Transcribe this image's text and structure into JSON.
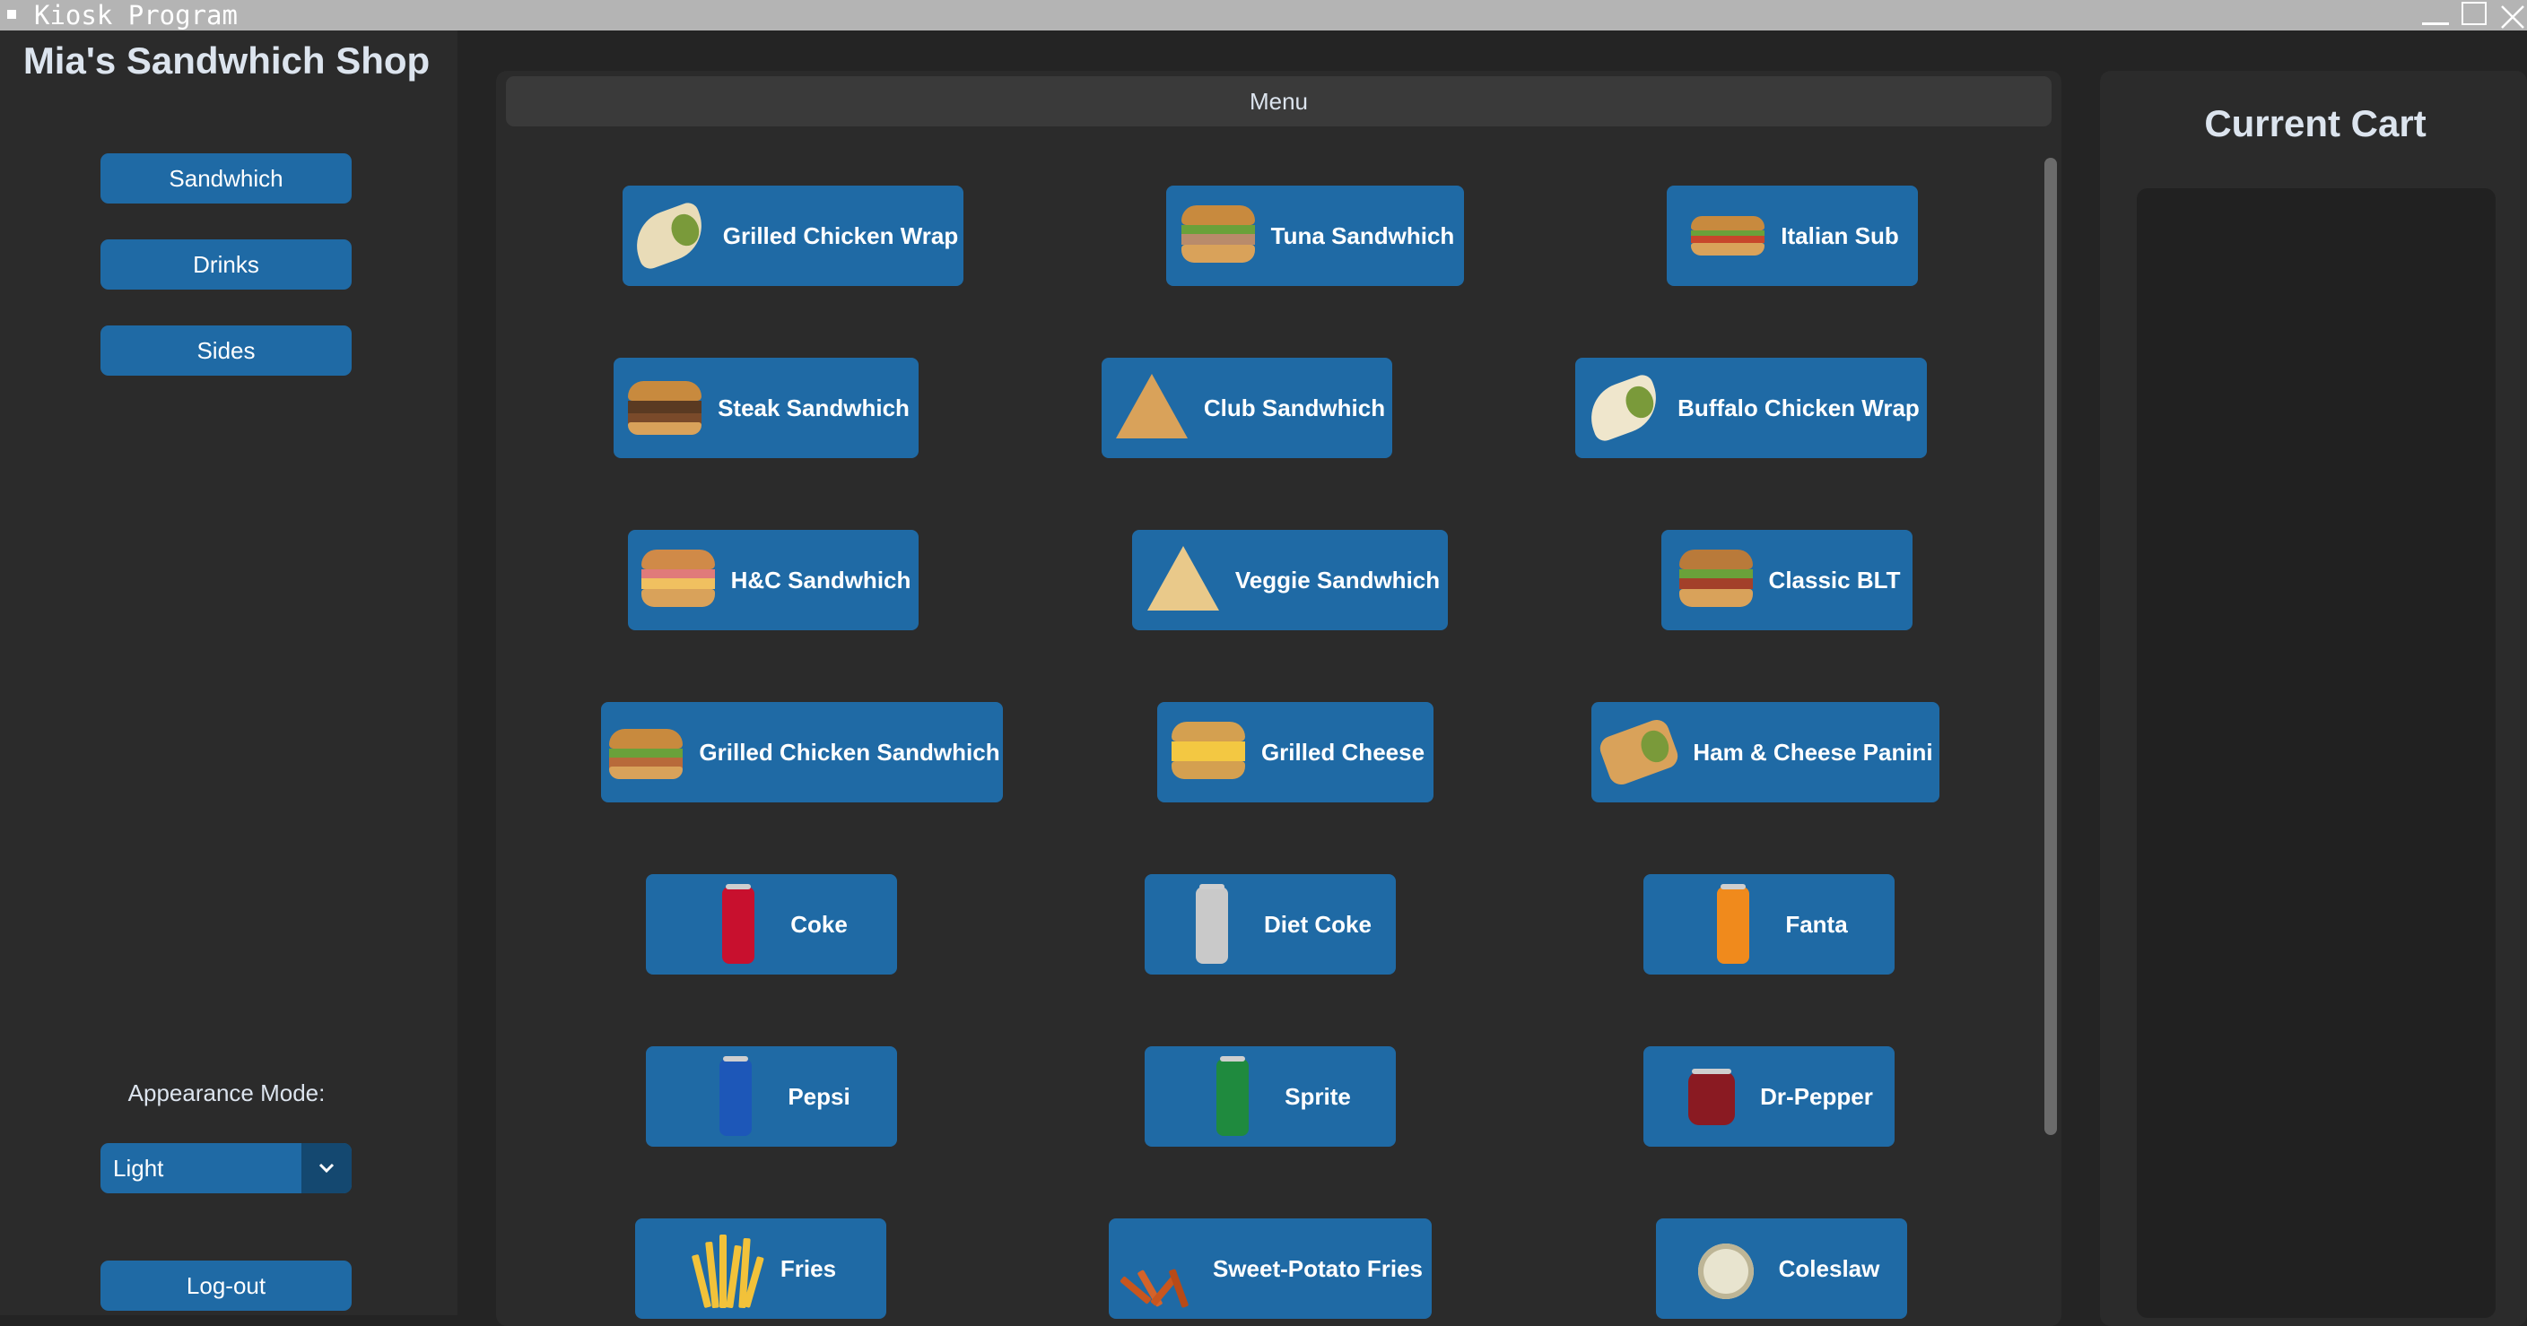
{
  "window": {
    "title": "Kiosk Program"
  },
  "sidebar": {
    "shop_name": "Mia's Sandwhich Shop",
    "categories": [
      {
        "label": "Sandwhich"
      },
      {
        "label": "Drinks"
      },
      {
        "label": "Sides"
      }
    ],
    "appearance_label": "Appearance Mode:",
    "appearance_value": "Light",
    "logout_label": "Log-out"
  },
  "menu": {
    "header": "Menu",
    "items": [
      {
        "label": "Grilled Chicken Wrap",
        "icon": "grilled-chicken-wrap-image"
      },
      {
        "label": "Tuna Sandwhich",
        "icon": "tuna-sandwich-image"
      },
      {
        "label": "Italian Sub",
        "icon": "italian-sub-image"
      },
      {
        "label": "Steak Sandwhich",
        "icon": "steak-sandwich-image"
      },
      {
        "label": "Club Sandwhich",
        "icon": "club-sandwich-image"
      },
      {
        "label": "Buffalo Chicken Wrap",
        "icon": "buffalo-chicken-wrap-image"
      },
      {
        "label": "H&C Sandwhich",
        "icon": "hc-sandwich-image"
      },
      {
        "label": "Veggie Sandwhich",
        "icon": "veggie-sandwich-image"
      },
      {
        "label": "Classic BLT",
        "icon": "classic-blt-image"
      },
      {
        "label": "Grilled Chicken Sandwhich",
        "icon": "grilled-chicken-sandwich-image"
      },
      {
        "label": "Grilled Cheese",
        "icon": "grilled-cheese-image"
      },
      {
        "label": "Ham & Cheese Panini",
        "icon": "ham-cheese-panini-image"
      },
      {
        "label": "Coke",
        "icon": "coke-can-image"
      },
      {
        "label": "Diet Coke",
        "icon": "diet-coke-can-image"
      },
      {
        "label": "Fanta",
        "icon": "fanta-can-image"
      },
      {
        "label": "Pepsi",
        "icon": "pepsi-can-image"
      },
      {
        "label": "Sprite",
        "icon": "sprite-can-image"
      },
      {
        "label": "Dr-Pepper",
        "icon": "dr-pepper-can-image"
      },
      {
        "label": "Fries",
        "icon": "fries-image"
      },
      {
        "label": "Sweet-Potato Fries",
        "icon": "sweet-potato-fries-image"
      },
      {
        "label": "Coleslaw",
        "icon": "coleslaw-image"
      }
    ]
  },
  "cart": {
    "title": "Current Cart"
  },
  "colors": {
    "button": "#1f6aa5",
    "background": "#242424",
    "panel": "#2b2b2b",
    "titlebar": "#b4b4b4"
  }
}
